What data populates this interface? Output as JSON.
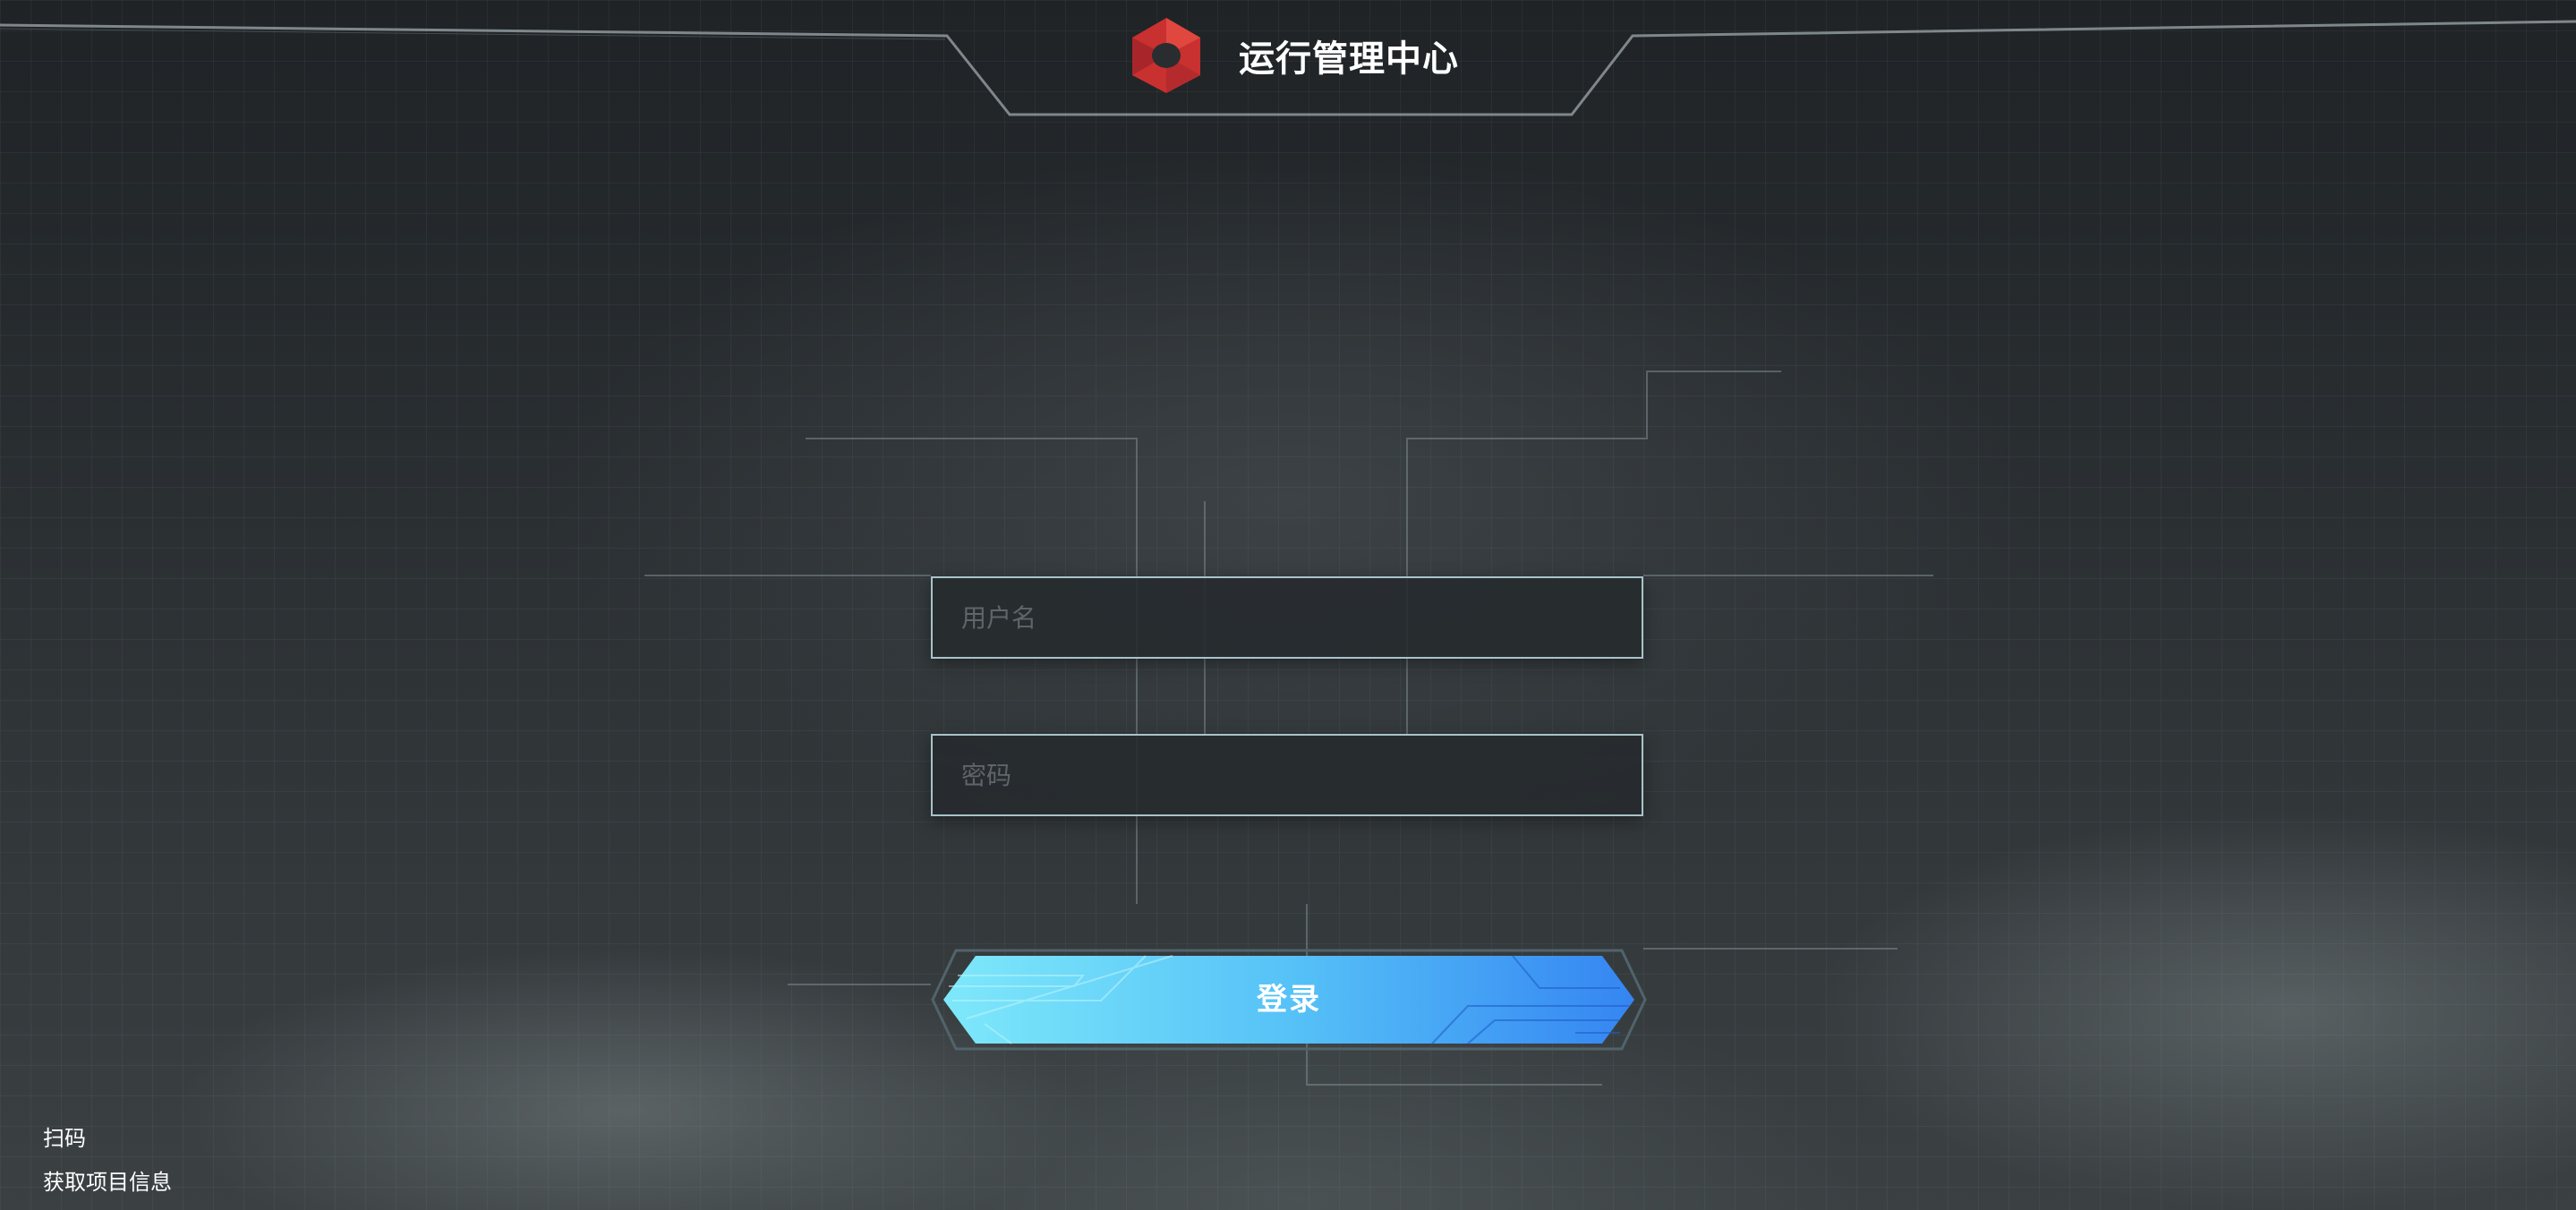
{
  "header": {
    "title": "运行管理中心",
    "logo_icon": "red-hexagon-logo-icon"
  },
  "login_form": {
    "username_placeholder": "用户名",
    "username_value": "",
    "password_placeholder": "密码",
    "password_value": "",
    "submit_label": "登录"
  },
  "footer_links": {
    "scan": "扫码",
    "project_info": "获取项目信息"
  },
  "colors": {
    "accent_start": "#7ee8fa",
    "accent_end": "#3585f2",
    "input_border": "#a9c3c9",
    "logo_red": "#c8312f"
  }
}
